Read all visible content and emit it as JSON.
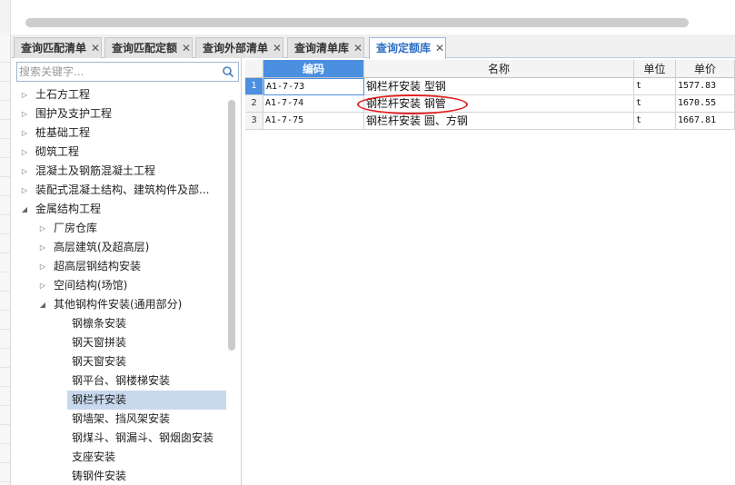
{
  "tabs": [
    {
      "label": "查询匹配清单",
      "active": false
    },
    {
      "label": "查询匹配定额",
      "active": false
    },
    {
      "label": "查询外部清单",
      "active": false
    },
    {
      "label": "查询清单库",
      "active": false
    },
    {
      "label": "查询定额库",
      "active": true
    }
  ],
  "tab_close_glyph": "✕",
  "search": {
    "placeholder": "搜索关键字...",
    "icon": "search-icon"
  },
  "tree": [
    {
      "label": "土石方工程",
      "state": "collapsed"
    },
    {
      "label": "围护及支护工程",
      "state": "collapsed"
    },
    {
      "label": "桩基础工程",
      "state": "collapsed"
    },
    {
      "label": "砌筑工程",
      "state": "collapsed"
    },
    {
      "label": "混凝土及钢筋混凝土工程",
      "state": "collapsed"
    },
    {
      "label": "装配式混凝土结构、建筑构件及部...",
      "state": "collapsed"
    },
    {
      "label": "金属结构工程",
      "state": "expanded"
    },
    {
      "label": "厂房仓库",
      "state": "collapsed"
    },
    {
      "label": "高层建筑(及超高层)",
      "state": "collapsed"
    },
    {
      "label": "超高层钢结构安装",
      "state": "collapsed"
    },
    {
      "label": "空间结构(场馆)",
      "state": "collapsed"
    },
    {
      "label": "其他钢构件安装(通用部分)",
      "state": "expanded"
    },
    {
      "label": "钢檩条安装",
      "state": "leaf"
    },
    {
      "label": "钢天窗拼装",
      "state": "leaf"
    },
    {
      "label": "钢天窗安装",
      "state": "leaf"
    },
    {
      "label": "钢平台、钢楼梯安装",
      "state": "leaf"
    },
    {
      "label": "钢栏杆安装",
      "state": "leaf",
      "selected": true
    },
    {
      "label": "钢墙架、挡风架安装",
      "state": "leaf"
    },
    {
      "label": "钢煤斗、钢漏斗、钢烟囱安装",
      "state": "leaf"
    },
    {
      "label": "支座安装",
      "state": "leaf"
    },
    {
      "label": "铸钢件安装",
      "state": "leaf"
    }
  ],
  "grid": {
    "columns": [
      "编码",
      "名称",
      "单位",
      "单价"
    ],
    "rows": [
      {
        "num": "1",
        "code": "A1-7-73",
        "name": "钢栏杆安装 型钢",
        "unit": "t",
        "price": "1577.83"
      },
      {
        "num": "2",
        "code": "A1-7-74",
        "name": "钢栏杆安装 钢管",
        "unit": "t",
        "price": "1670.55"
      },
      {
        "num": "3",
        "code": "A1-7-75",
        "name": "钢栏杆安装 圆、方钢",
        "unit": "t",
        "price": "1667.81"
      }
    ]
  },
  "colors": {
    "accent": "#4a8fe0",
    "active_tab_text": "#2f6fc4",
    "selected_tree": "#c8d9ee",
    "annotation": "#e02020"
  }
}
